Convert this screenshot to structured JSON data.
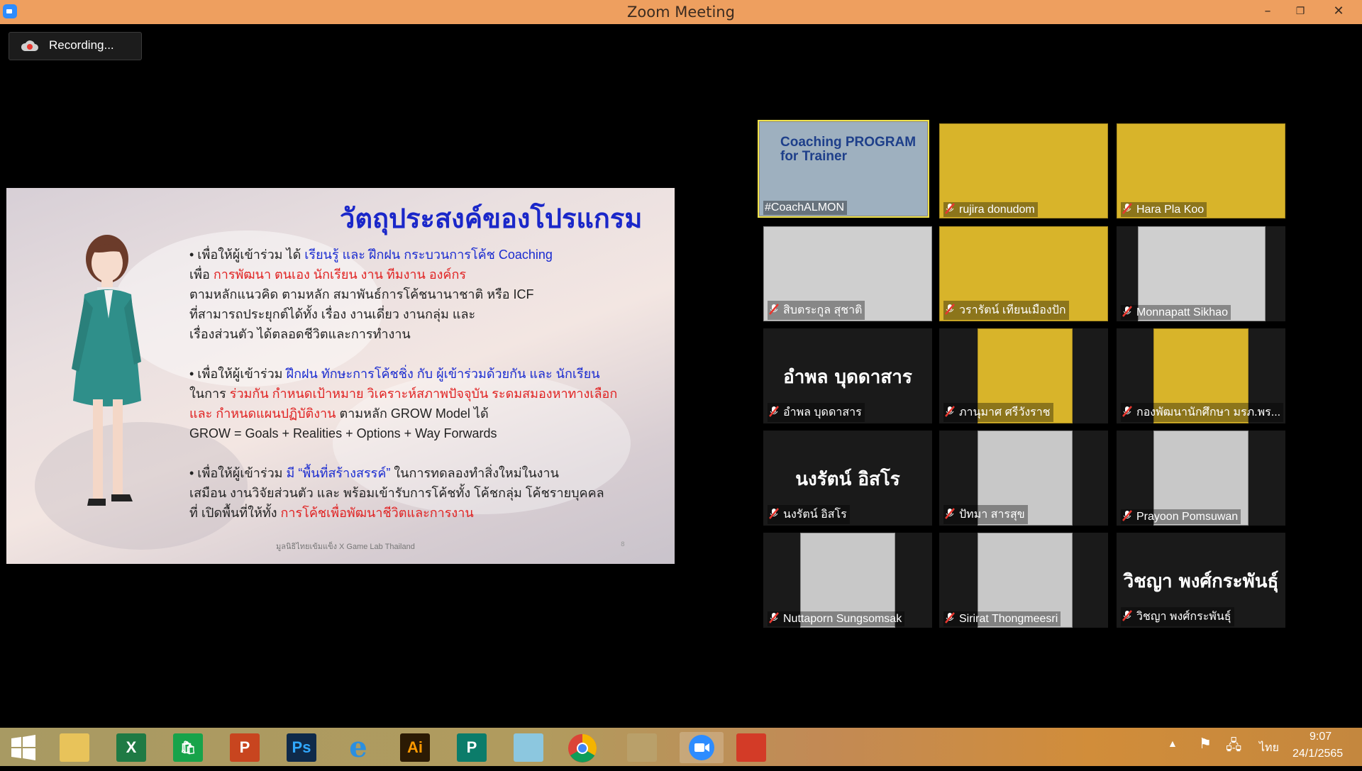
{
  "window": {
    "title": "Zoom Meeting",
    "minimize": "–",
    "restore": "❐",
    "close": "✕"
  },
  "recording": {
    "label": "Recording..."
  },
  "slide": {
    "title": "วัตถุประสงค์ของโปรแกรม",
    "p1": {
      "l1a": "• เพื่อให้ผู้เข้าร่วม ได้ ",
      "l1b": "เรียนรู้ และ ฝึกฝน กระบวนการโค้ช Coaching",
      "l2a": "เพื่อ ",
      "l2b": "การพัฒนา ตนเอง นักเรียน งาน ทีมงาน องค์กร",
      "l3": "ตามหลักแนวคิด ตามหลัก สมาพันธ์การโค้ชนานาชาติ หรือ ICF",
      "l4": "ที่สามารถประยุกต์ได้ทั้ง เรื่อง งานเดี่ยว งานกลุ่ม และ",
      "l5": "เรื่องส่วนตัว ได้ตลอดชีวิตและการทำงาน"
    },
    "p2": {
      "l1a": "• เพื่อให้ผู้เข้าร่วม ",
      "l1b": "ฝึกฝน ทักษะการโค้ชชิ่ง กับ ผู้เข้าร่วมด้วยกัน และ นักเรียน",
      "l2a": "ในการ ",
      "l2b": "ร่วมกัน กำหนดเป้าหมาย วิเคราะห์สภาพปัจจุบัน ระดมสมองหาทางเลือก",
      "l3a": "และ กำหนดแผนปฏิบัติงาน",
      "l3b": " ตามหลัก GROW Model ได้",
      "l4": "GROW = Goals + Realities + Options + Way Forwards"
    },
    "p3": {
      "l1a": "• เพื่อให้ผู้เข้าร่วม ",
      "l1b": "มี “พื้นที่สร้างสรรค์”",
      "l1c": " ในการทดลองทำสิ่งใหม่ในงาน",
      "l2": "เสมือน งานวิจัยส่วนตัว และ พร้อมเข้ารับการโค้ชทั้ง โค้ชกลุ่ม โค้ชรายบุคคล",
      "l3a": "ที่ เปิดพื้นที่ให้ทั้ง ",
      "l3b": "การโค้ชเพื่อพัฒนาชีวิตและการงาน"
    },
    "footer": "มูลนิธิไทยเข้มแข็ง X Game Lab Thailand",
    "page": "8"
  },
  "participants": [
    {
      "name": "#CoachALMON",
      "muted": false,
      "video": "photo",
      "banner": "Coaching PROGRAM for Trainer",
      "active": true
    },
    {
      "name": "rujira donudom",
      "muted": true,
      "video": "photo-yellow"
    },
    {
      "name": "Hara Pla Koo",
      "muted": true,
      "video": "photo-yellow"
    },
    {
      "name": "สิบตระกูล สุชาติ",
      "muted": true,
      "video": "photo"
    },
    {
      "name": "วรารัตน์ เทียนเมืองปัก",
      "muted": true,
      "video": "photo-yellow"
    },
    {
      "name": "Monnapatt Sikhao",
      "muted": true,
      "video": "photo"
    },
    {
      "name": "อำพล บุดดาสาร",
      "muted": true,
      "video": "none",
      "display": "อำพล บุดดาสาร"
    },
    {
      "name": "ภานุมาศ ศรีวังราช",
      "muted": true,
      "video": "photo-yellow-small"
    },
    {
      "name": "กองพัฒนานักศึกษา มรภ.พร...",
      "muted": true,
      "video": "photo-yellow-small"
    },
    {
      "name": "นงรัตน์ อิสโร",
      "muted": true,
      "video": "none",
      "display": "นงรัตน์ อิสโร"
    },
    {
      "name": "ปัทมา สารสุข",
      "muted": true,
      "video": "photo-small"
    },
    {
      "name": "Prayoon Pomsuwan",
      "muted": true,
      "video": "photo-small"
    },
    {
      "name": "Nuttaporn Sungsomsak",
      "muted": true,
      "video": "photo-small"
    },
    {
      "name": "Sirirat Thongmeesri",
      "muted": true,
      "video": "photo-small"
    },
    {
      "name": "วิชญา พงศ์กระพันธุ์",
      "muted": true,
      "video": "none",
      "display": "วิชญา พงศ์กระพันธุ์"
    }
  ],
  "taskbar": {
    "apps": [
      "start",
      "file-explorer",
      "excel",
      "store",
      "powerpoint",
      "photoshop",
      "internet-explorer",
      "illustrator",
      "publisher",
      "eraser",
      "chrome",
      "snipping-tool",
      "zoom",
      "office-lens"
    ],
    "app_letters": {
      "excel": "X",
      "powerpoint": "P",
      "photoshop": "Ps",
      "illustrator": "Ai",
      "publisher": "P"
    },
    "tray": {
      "language": "ไทย",
      "time": "9:07",
      "date": "24/1/2565"
    }
  },
  "colors": {
    "titlebar": "#ee9f5f",
    "active_speaker": "#f0e24a",
    "muted_icon": "#e8372f"
  }
}
